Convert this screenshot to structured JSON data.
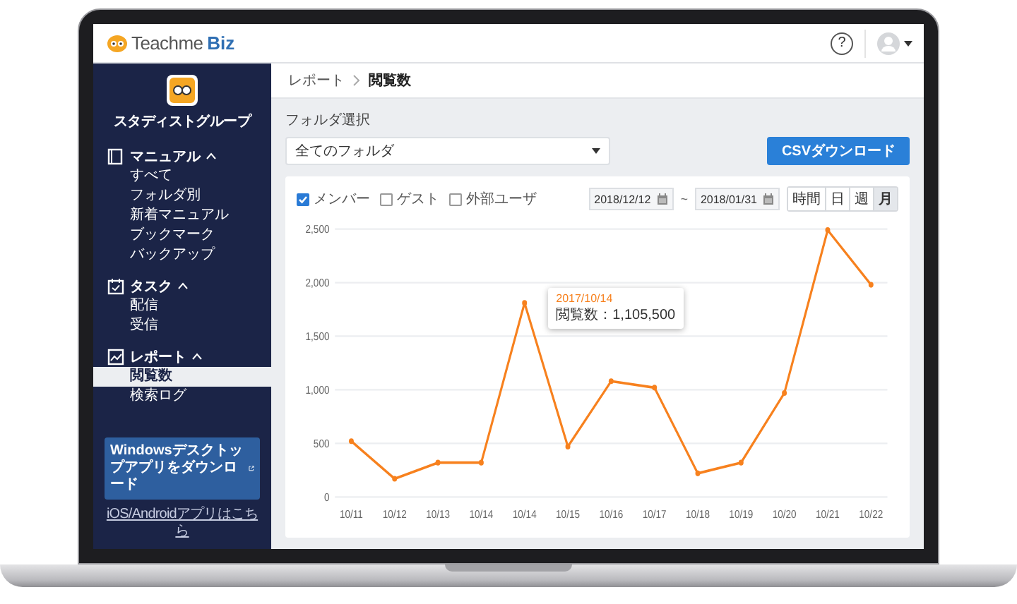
{
  "header": {
    "logo": {
      "name": "Teachme",
      "suffix": "Biz"
    },
    "help": "?"
  },
  "sidebar": {
    "group_name": "スタディストグループ",
    "sections": [
      {
        "title": "マニュアル",
        "kind": "manual",
        "expanded": true,
        "items": [
          {
            "label": "すべて",
            "selected": false
          },
          {
            "label": "フォルダ別",
            "selected": false
          },
          {
            "label": "新着マニュアル",
            "selected": false
          },
          {
            "label": "ブックマーク",
            "selected": false
          },
          {
            "label": "バックアップ",
            "selected": false
          }
        ]
      },
      {
        "title": "タスク",
        "kind": "task",
        "expanded": true,
        "items": [
          {
            "label": "配信",
            "selected": false
          },
          {
            "label": "受信",
            "selected": false
          }
        ]
      },
      {
        "title": "レポート",
        "kind": "report",
        "expanded": true,
        "items": [
          {
            "label": "閲覧数",
            "selected": true
          },
          {
            "label": "検索ログ",
            "selected": false
          }
        ]
      }
    ],
    "download_button": "Windowsデスクトップアプリをダウンロード",
    "app_link": "iOS/Androidアプリはこちら"
  },
  "breadcrumb": [
    "レポート",
    "閲覧数"
  ],
  "folder": {
    "label": "フォルダ選択",
    "value": "全てのフォルダ"
  },
  "csv_button": "CSVダウンロード",
  "filters": [
    {
      "label": "メンバー",
      "checked": true
    },
    {
      "label": "ゲスト",
      "checked": false
    },
    {
      "label": "外部ユーザ",
      "checked": false
    }
  ],
  "date_range": {
    "start": "2018/12/12",
    "separator": "~",
    "end": "2018/01/31"
  },
  "periods": [
    {
      "label": "時間",
      "selected": false
    },
    {
      "label": "日",
      "selected": false
    },
    {
      "label": "週",
      "selected": false
    },
    {
      "label": "月",
      "selected": true
    }
  ],
  "chart": {
    "tooltip": {
      "title": "2017/10/14",
      "text": "閲覧数：1,105,500"
    },
    "chart_data": {
      "type": "line",
      "categories": [
        "10/11",
        "10/12",
        "10/13",
        "10/14",
        "10/14",
        "10/15",
        "10/16",
        "10/17",
        "10/18",
        "10/19",
        "10/20",
        "10/21",
        "10/22"
      ],
      "grid": true,
      "series": [
        {
          "color": "#f7811e",
          "marker": true,
          "values": [
            520,
            170,
            320,
            320,
            1810,
            470,
            1080,
            1020,
            220,
            320,
            970,
            2490,
            1980
          ]
        }
      ],
      "ylim": [
        0,
        2500
      ],
      "yticks": [
        {
          "value": 0,
          "label": "0"
        },
        {
          "value": 500,
          "label": "500"
        },
        {
          "value": 1000,
          "label": "1,000"
        },
        {
          "value": 1500,
          "label": "1,500"
        },
        {
          "value": 2000,
          "label": "2,000"
        },
        {
          "value": 2500,
          "label": "2,500"
        }
      ]
    }
  }
}
